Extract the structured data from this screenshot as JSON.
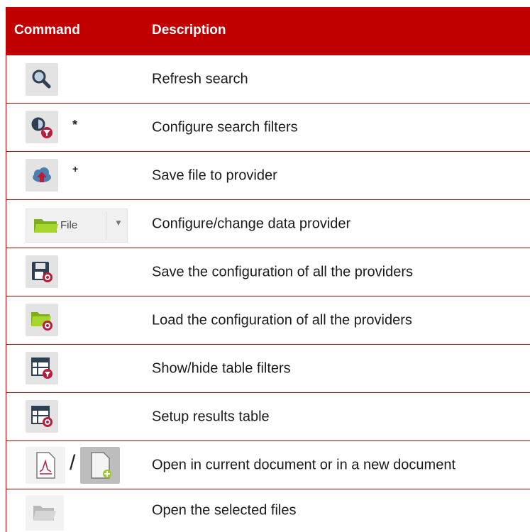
{
  "header": {
    "command": "Command",
    "description": "Description"
  },
  "rows": [
    {
      "icon": "search-icon",
      "marker": "",
      "description": "Refresh search"
    },
    {
      "icon": "search-filter-icon",
      "marker": "*",
      "description": "Configure search filters"
    },
    {
      "icon": "cloud-upload-icon",
      "marker": "+",
      "description": "Save file to provider"
    },
    {
      "icon": "folder-icon",
      "combo_label": "File",
      "description": "Configure/change data provider"
    },
    {
      "icon": "save-config-icon",
      "description": "Save the configuration of all the providers"
    },
    {
      "icon": "folder-settings-icon",
      "description": "Load the configuration of all the providers"
    },
    {
      "icon": "table-filter-icon",
      "description": "Show/hide table filters"
    },
    {
      "icon": "table-settings-icon",
      "description": "Setup results table"
    },
    {
      "icon": "document-icon",
      "separator": "/",
      "icon2": "new-document-icon",
      "description": "Open in current document or in a new document"
    },
    {
      "icon": "open-folder-icon",
      "description": "Open the selected files"
    }
  ],
  "colors": {
    "header_bg": "#c00000",
    "rule": "#c00000",
    "icon_bg": "#e3e3e3",
    "accent_red": "#b81e3c",
    "accent_green": "#9ac92a"
  }
}
